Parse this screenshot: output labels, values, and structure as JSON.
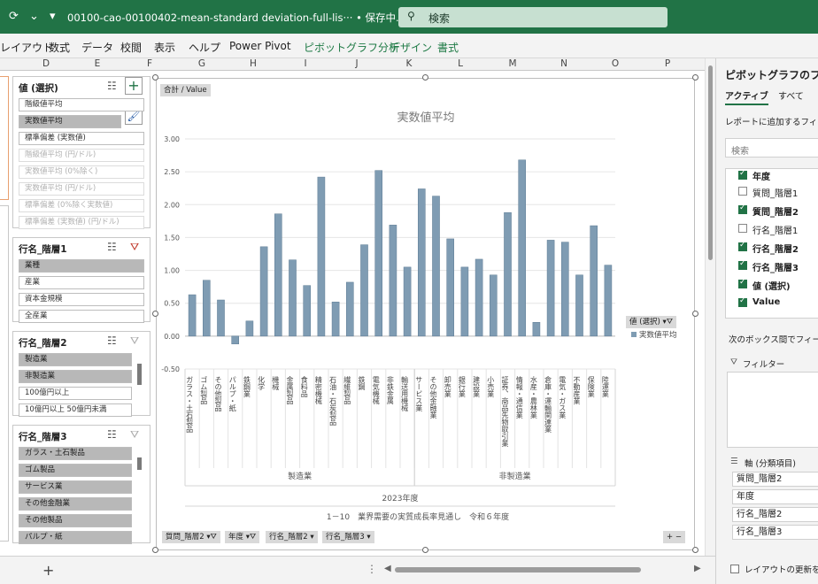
{
  "titlebar": {
    "qat": "⟳ ⌄ ▾",
    "document": "00100-cao-00100402-mean-standard deviation-full-lis··· • 保存中... ⌄",
    "search_placeholder": "検索"
  },
  "ribbon_tabs": [
    "レイアウト",
    "数式",
    "データ",
    "校閲",
    "表示",
    "ヘルプ",
    "Power Pivot"
  ],
  "ribbon_context_tabs": [
    "ピボットグラフ分析",
    "デザイン",
    "書式"
  ],
  "columns": [
    "D",
    "E",
    "F",
    "G",
    "H",
    "I",
    "J",
    "K",
    "L",
    "M",
    "N",
    "O",
    "P"
  ],
  "slicers": {
    "values": {
      "title": "値 (選択)",
      "items": [
        {
          "label": "階級値平均",
          "state": "un"
        },
        {
          "label": "実数値平均",
          "state": "sel"
        },
        {
          "label": "標準偏差 (実数値)",
          "state": "un"
        },
        {
          "label": "階級値平均 (円/ドル)",
          "state": "dis"
        },
        {
          "label": "実数値平均 (0%除く)",
          "state": "dis"
        },
        {
          "label": "実数値平均 (円/ドル)",
          "state": "dis"
        },
        {
          "label": "標準偏差 (0%除く実数値)",
          "state": "dis"
        },
        {
          "label": "標準偏差 (実数値) (円/ドル)",
          "state": "dis"
        }
      ]
    },
    "row1": {
      "title": "行名_階層1",
      "items": [
        {
          "label": "業種",
          "state": "sel"
        },
        {
          "label": "産業",
          "state": "un"
        },
        {
          "label": "資本金規模",
          "state": "un"
        },
        {
          "label": "全産業",
          "state": "un"
        }
      ]
    },
    "row2": {
      "title": "行名_階層2",
      "items": [
        {
          "label": "製造業",
          "state": "sel"
        },
        {
          "label": "非製造業",
          "state": "sel"
        },
        {
          "label": "100億円以上",
          "state": "un"
        },
        {
          "label": "10億円以上 50億円未満",
          "state": "un"
        }
      ]
    },
    "row3": {
      "title": "行名_階層3",
      "items": [
        {
          "label": "ガラス・土石製品",
          "state": "sel"
        },
        {
          "label": "ゴム製品",
          "state": "sel"
        },
        {
          "label": "サービス業",
          "state": "sel"
        },
        {
          "label": "その他金融業",
          "state": "sel"
        },
        {
          "label": "その他製品",
          "state": "sel"
        },
        {
          "label": "パルプ・紙",
          "state": "sel"
        }
      ]
    }
  },
  "chart": {
    "value_button": "合計 / Value",
    "legend_button": "値 (選択)",
    "bottom_buttons": [
      "質問_階層2",
      "年度",
      "行名_階層2",
      "行名_階層3"
    ],
    "legend_entry": "実数値平均",
    "legend_color": "#7f9cb3",
    "zoom_buttons": "+ −"
  },
  "chart_data": {
    "type": "bar",
    "title": "実数値平均",
    "ylim": [
      -0.5,
      3.0
    ],
    "yticks": [
      "3.00",
      "2.50",
      "2.00",
      "1.50",
      "1.00",
      "0.50",
      "0.00",
      "-0.50"
    ],
    "categories": [
      "ガラス・土石製品",
      "ゴム製品",
      "その他製品",
      "パルプ・紙",
      "鉄鋼業",
      "化学",
      "機械",
      "金属製品",
      "食料品",
      "精密機械",
      "石油・石炭製品",
      "繊維製品",
      "鉄鋼",
      "電気機械",
      "非鉄金属",
      "輸送用機械",
      "サービス業",
      "その他金融業",
      "卸売業",
      "銀行業",
      "建設業",
      "小売業",
      "証券、商品先物取引業",
      "情報・通信業",
      "水産・農林業",
      "倉庫・運輸関連業",
      "電気・ガス業",
      "不動産業",
      "保険業",
      "陸運業"
    ],
    "values": [
      0.63,
      0.85,
      0.55,
      -0.12,
      0.23,
      1.36,
      1.86,
      1.16,
      0.77,
      2.42,
      0.52,
      0.82,
      1.39,
      2.52,
      1.69,
      1.05,
      2.24,
      2.13,
      1.48,
      1.05,
      1.17,
      0.93,
      1.88,
      2.68,
      0.21,
      1.46,
      1.43,
      0.93,
      1.68,
      1.08
    ],
    "groups": [
      {
        "label": "製造業",
        "start": 0,
        "end": 15
      },
      {
        "label": "非製造業",
        "start": 16,
        "end": 29
      }
    ],
    "year_label": "2023年度",
    "xlabel": "1－10　業界需要の実質成長率見通し　令和６年度"
  },
  "pane": {
    "title": "ピボットグラフのフィール",
    "tabs": [
      "アクティブ",
      "すべて"
    ],
    "hint": "レポートに追加するフィール",
    "search_placeholder": "検索",
    "fields": [
      {
        "label": "年度",
        "checked": true
      },
      {
        "label": "質問_階層1",
        "checked": false
      },
      {
        "label": "質問_階層2",
        "checked": true
      },
      {
        "label": "行名_階層1",
        "checked": false
      },
      {
        "label": "行名_階層2",
        "checked": true
      },
      {
        "label": "行名_階層3",
        "checked": true
      },
      {
        "label": "値 (選択)",
        "checked": true
      },
      {
        "label": "Value",
        "checked": true
      }
    ],
    "drag_hint": "次のボックス間でフィールドを",
    "filter_label": "フィルター",
    "axis_label": "軸 (分類項目)",
    "axis_items": [
      "質問_階層2",
      "年度",
      "行名_階層2",
      "行名_階層3"
    ],
    "defer_label": "レイアウトの更新を保"
  }
}
